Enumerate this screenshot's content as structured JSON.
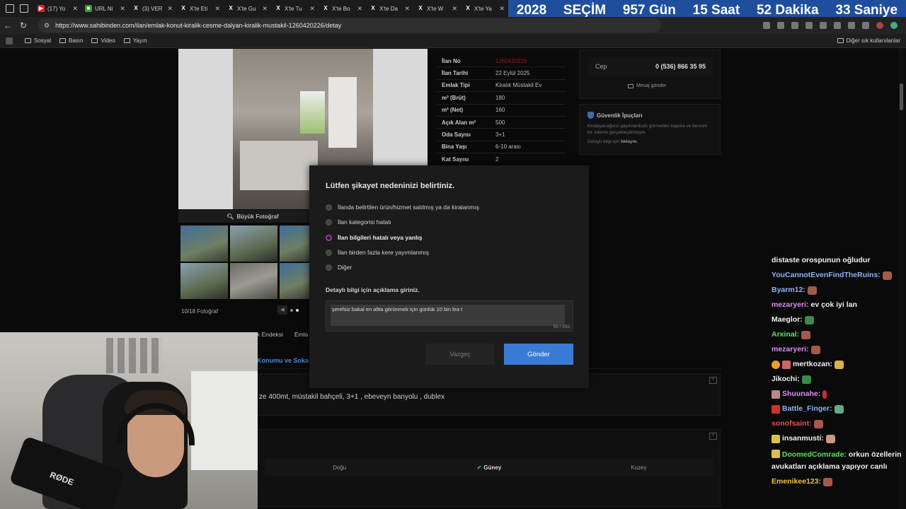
{
  "browser": {
    "tabs": [
      {
        "title": "(17) Yo",
        "fav_color": "#e02020",
        "fav_icon": "youtube-icon"
      },
      {
        "title": "URL Ni",
        "fav_color": "#3a9a3a",
        "fav_icon": "url-icon"
      },
      {
        "title": "(3) VER",
        "fav_color": "#000000",
        "fav_icon": "x-icon"
      },
      {
        "title": "X'te Eti",
        "fav_color": "#000000",
        "fav_icon": "x-icon"
      },
      {
        "title": "X'te Gu",
        "fav_color": "#000000",
        "fav_icon": "x-icon"
      },
      {
        "title": "X'te Tu",
        "fav_color": "#000000",
        "fav_icon": "x-icon"
      },
      {
        "title": "X'te Bo",
        "fav_color": "#000000",
        "fav_icon": "x-icon"
      },
      {
        "title": "X'te Da",
        "fav_color": "#000000",
        "fav_icon": "x-icon"
      },
      {
        "title": "X'te W",
        "fav_color": "#000000",
        "fav_icon": "x-icon"
      },
      {
        "title": "X'te Ya",
        "fav_color": "#000000",
        "fav_icon": "x-icon"
      }
    ],
    "url": "https://www.sahibinden.com/ilan/emlak-konut-kiralik-cesme-dalyan-kiralik-mustakil-1260420226/detay",
    "bookmarks": [
      "Sosyal",
      "Basın",
      "Video",
      "Yayın"
    ],
    "other_bookmarks": "Diğer sık kullanılanlar"
  },
  "countdown": {
    "year": "2028",
    "label": "SEÇİM",
    "days": "957 Gün",
    "hours": "15 Saat",
    "minutes": "52 Dakika",
    "seconds": "33 Saniye"
  },
  "listing": {
    "big_photo": "Büyük Fotoğraf",
    "photo_count": "10/18 Fotoğraf",
    "details": [
      {
        "k": "İlan No",
        "v": "1260420226",
        "red": true
      },
      {
        "k": "İlan Tarihi",
        "v": "22 Eylül 2025"
      },
      {
        "k": "Emlak Tipi",
        "v": "Kiralık Müstakil Ev"
      },
      {
        "k": "m² (Brüt)",
        "v": "180"
      },
      {
        "k": "m² (Net)",
        "v": "160"
      },
      {
        "k": "Açık Alan m²",
        "v": "500"
      },
      {
        "k": "Oda Sayısı",
        "v": "3+1"
      },
      {
        "k": "Bina Yaşı",
        "v": "6-10 arası"
      },
      {
        "k": "Kat Sayısı",
        "v": "2"
      }
    ],
    "phone_label": "Cep",
    "phone_number": "0 (536) 866 35 95",
    "send_message": "Mesaj gönder",
    "safety_title": "Güvenlik İpuçları",
    "safety_text": "Kiralayacağınız gayrimenkulü görmeden kapora ve benzeri bir ödeme gerçekleştirmeyin.",
    "safety_more_prefix": "Detaylı bilgi için",
    "safety_more_link": "tıklayın.",
    "tab_partial_1": "k Endeksi",
    "tab_partial_2": "Emla",
    "location_tab": "Konumu ve Soka",
    "description": "ze 400mt, müstakil bahçeli, 3+1 , ebeveyn banyolu , dublex",
    "directions": {
      "west": "Doğu",
      "south": "Güney",
      "north": "Kuzey"
    }
  },
  "modal": {
    "title": "Lütfen şikayet nedeninizi belirtiniz.",
    "options": [
      "İlanda belirtilen ürün/hizmet satılmış ya da kiralanmış",
      "İlan kategorisi hatalı",
      "İlan bilgileri hatalı veya yanlış",
      "İlan birden fazla kere yayımlanmış",
      "Diğer"
    ],
    "selected_index": 2,
    "detail_label": "Detaylı bilgi için açıklama giriniz.",
    "textarea_value": "şerefsiz bakal en altta görünmek için günlük 10 bin lira t",
    "char_count": "58 / 256",
    "cancel_label": "Vazgeç",
    "send_label": "Gönder"
  },
  "webcam": {
    "mic_brand": "RØDE"
  },
  "chat": [
    {
      "user": "",
      "msg": "distaste orospunun oğludur",
      "color": "#f0f0f0"
    },
    {
      "user": "YouCannotEvenFindTheRuins:",
      "msg": "",
      "color": "#8ab4f8"
    },
    {
      "user": "Byarm12:",
      "msg": "",
      "color": "#8ab4f8"
    },
    {
      "user": "mezaryeri:",
      "msg": "ev çok iyi lan",
      "color": "#d88ef0"
    },
    {
      "user": "Maeglor:",
      "msg": "",
      "color": "#f0f0f0"
    },
    {
      "user": "Arxinal:",
      "msg": "",
      "color": "#5ce05c"
    },
    {
      "user": "mezaryeri:",
      "msg": "",
      "color": "#d88ef0"
    },
    {
      "user": "mertkozan:",
      "msg": "",
      "color": "#f0f0f0"
    },
    {
      "user": "Jikochi:",
      "msg": "",
      "color": "#f0f0f0"
    },
    {
      "user": "Shuunahe:",
      "msg": "",
      "color": "#d88ef0"
    },
    {
      "user": "Battle_Finger:",
      "msg": "",
      "color": "#8ab4f8"
    },
    {
      "user": "sonofsaint:",
      "msg": "",
      "color": "#e05050"
    },
    {
      "user": "insanmusti:",
      "msg": "",
      "color": "#f0f0f0"
    },
    {
      "user": "DoomedComrade:",
      "msg": "orkun özellerin avukatları açıklama yapıyor canlı",
      "color": "#5ce05c"
    },
    {
      "user": "Emenikee123:",
      "msg": "",
      "color": "#f0c040"
    }
  ]
}
